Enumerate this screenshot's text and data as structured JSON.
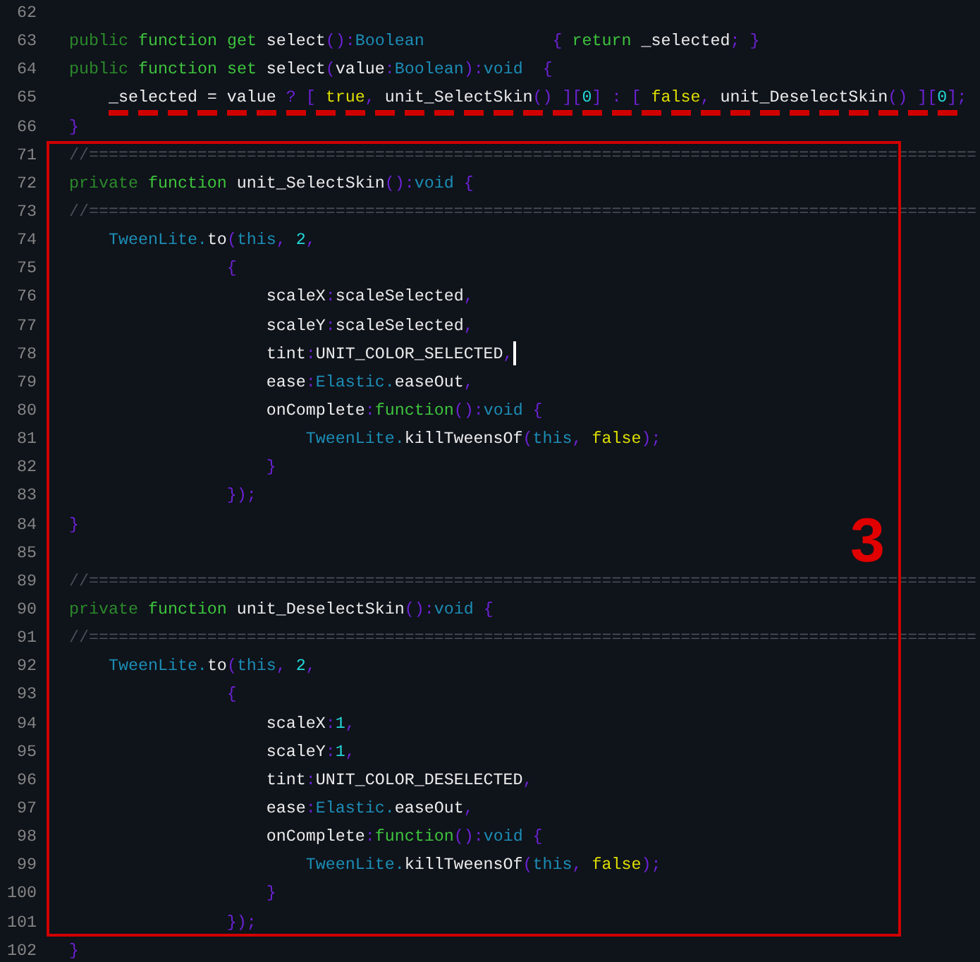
{
  "editor": {
    "lines": [
      {
        "number": "62",
        "cursor": false
      },
      {
        "number": "63",
        "cursor": false,
        "tokens": [
          {
            "kind": "storage",
            "text": "public"
          },
          {
            "kind": "keyword",
            "text": " function"
          },
          {
            "kind": "keyword",
            "text": " get"
          },
          {
            "kind": "plain",
            "text": " select"
          },
          {
            "kind": "punct",
            "text": "():"
          },
          {
            "kind": "type",
            "text": "Boolean"
          },
          {
            "kind": "punct",
            "text": "             {"
          },
          {
            "kind": "keyword",
            "text": " return"
          },
          {
            "kind": "plain",
            "text": " _selected"
          },
          {
            "kind": "punct",
            "text": "; }"
          }
        ]
      },
      {
        "number": "64",
        "cursor": false,
        "tokens": [
          {
            "kind": "storage",
            "text": "public"
          },
          {
            "kind": "keyword",
            "text": " function"
          },
          {
            "kind": "keyword",
            "text": " set"
          },
          {
            "kind": "plain",
            "text": " select"
          },
          {
            "kind": "punct",
            "text": "("
          },
          {
            "kind": "plain",
            "text": "value"
          },
          {
            "kind": "punct",
            "text": ":"
          },
          {
            "kind": "type",
            "text": "Boolean"
          },
          {
            "kind": "punct",
            "text": "):"
          },
          {
            "kind": "type",
            "text": "void"
          },
          {
            "kind": "punct",
            "text": "  {"
          }
        ]
      },
      {
        "number": "65",
        "cursor": false,
        "tokens": [
          {
            "kind": "plain",
            "text": "    _selected = value "
          },
          {
            "kind": "punct",
            "text": "? [ "
          },
          {
            "kind": "bool",
            "text": "true"
          },
          {
            "kind": "punct",
            "text": ", "
          },
          {
            "kind": "plain",
            "text": "unit_SelectSkin"
          },
          {
            "kind": "punct",
            "text": "() ]["
          },
          {
            "kind": "number",
            "text": "0"
          },
          {
            "kind": "punct",
            "text": "] : [ "
          },
          {
            "kind": "bool",
            "text": "false"
          },
          {
            "kind": "punct",
            "text": ", "
          },
          {
            "kind": "plain",
            "text": "unit_DeselectSkin"
          },
          {
            "kind": "punct",
            "text": "() ]["
          },
          {
            "kind": "number",
            "text": "0"
          },
          {
            "kind": "punct",
            "text": "];"
          }
        ]
      },
      {
        "number": "66",
        "cursor": false,
        "tokens": [
          {
            "kind": "punct",
            "text": "}"
          }
        ]
      },
      {
        "number": "71",
        "cursor": false,
        "tokens": [
          {
            "kind": "comment",
            "text": "//=========================================================================================="
          }
        ]
      },
      {
        "number": "72",
        "cursor": false,
        "tokens": [
          {
            "kind": "storage",
            "text": "private"
          },
          {
            "kind": "keyword",
            "text": " function"
          },
          {
            "kind": "plain",
            "text": " unit_SelectSkin"
          },
          {
            "kind": "punct",
            "text": "():"
          },
          {
            "kind": "type",
            "text": "void"
          },
          {
            "kind": "punct",
            "text": " {"
          }
        ]
      },
      {
        "number": "73",
        "cursor": false,
        "tokens": [
          {
            "kind": "comment",
            "text": "//=========================================================================================="
          }
        ]
      },
      {
        "number": "74",
        "cursor": false,
        "tokens": [
          {
            "kind": "type",
            "text": "    TweenLite."
          },
          {
            "kind": "plain",
            "text": "to"
          },
          {
            "kind": "punct",
            "text": "("
          },
          {
            "kind": "type",
            "text": "this"
          },
          {
            "kind": "punct",
            "text": ", "
          },
          {
            "kind": "number",
            "text": "2"
          },
          {
            "kind": "punct",
            "text": ","
          }
        ]
      },
      {
        "number": "75",
        "cursor": false,
        "tokens": [
          {
            "kind": "punct",
            "text": "                {"
          }
        ]
      },
      {
        "number": "76",
        "cursor": false,
        "tokens": [
          {
            "kind": "plain",
            "text": "                    scaleX"
          },
          {
            "kind": "punct",
            "text": ":"
          },
          {
            "kind": "plain",
            "text": "scaleSelected"
          },
          {
            "kind": "punct",
            "text": ","
          }
        ]
      },
      {
        "number": "77",
        "cursor": false,
        "tokens": [
          {
            "kind": "plain",
            "text": "                    scaleY"
          },
          {
            "kind": "punct",
            "text": ":"
          },
          {
            "kind": "plain",
            "text": "scaleSelected"
          },
          {
            "kind": "punct",
            "text": ","
          }
        ]
      },
      {
        "number": "78",
        "cursor": true,
        "tokens": [
          {
            "kind": "plain",
            "text": "                    tint"
          },
          {
            "kind": "punct",
            "text": ":"
          },
          {
            "kind": "plain",
            "text": "UNIT_COLOR_SELECTED"
          },
          {
            "kind": "punct",
            "text": ","
          }
        ]
      },
      {
        "number": "79",
        "cursor": false,
        "tokens": [
          {
            "kind": "plain",
            "text": "                    ease"
          },
          {
            "kind": "punct",
            "text": ":"
          },
          {
            "kind": "type",
            "text": "Elastic."
          },
          {
            "kind": "plain",
            "text": "easeOut"
          },
          {
            "kind": "punct",
            "text": ","
          }
        ]
      },
      {
        "number": "80",
        "cursor": false,
        "tokens": [
          {
            "kind": "plain",
            "text": "                    onComplete"
          },
          {
            "kind": "punct",
            "text": ":"
          },
          {
            "kind": "keyword",
            "text": "function"
          },
          {
            "kind": "punct",
            "text": "():"
          },
          {
            "kind": "type",
            "text": "void"
          },
          {
            "kind": "punct",
            "text": " {"
          }
        ]
      },
      {
        "number": "81",
        "cursor": false,
        "tokens": [
          {
            "kind": "type",
            "text": "                        TweenLite."
          },
          {
            "kind": "plain",
            "text": "killTweensOf"
          },
          {
            "kind": "punct",
            "text": "("
          },
          {
            "kind": "type",
            "text": "this"
          },
          {
            "kind": "punct",
            "text": ", "
          },
          {
            "kind": "bool",
            "text": "false"
          },
          {
            "kind": "punct",
            "text": ");"
          }
        ]
      },
      {
        "number": "82",
        "cursor": false,
        "tokens": [
          {
            "kind": "punct",
            "text": "                    }"
          }
        ]
      },
      {
        "number": "83",
        "cursor": false,
        "tokens": [
          {
            "kind": "punct",
            "text": "                });"
          }
        ]
      },
      {
        "number": "84",
        "cursor": false,
        "tokens": [
          {
            "kind": "punct",
            "text": "}"
          }
        ]
      },
      {
        "number": "85",
        "cursor": false
      },
      {
        "number": "89",
        "cursor": false,
        "tokens": [
          {
            "kind": "comment",
            "text": "//=========================================================================================="
          }
        ]
      },
      {
        "number": "90",
        "cursor": false,
        "tokens": [
          {
            "kind": "storage",
            "text": "private"
          },
          {
            "kind": "keyword",
            "text": " function"
          },
          {
            "kind": "plain",
            "text": " unit_DeselectSkin"
          },
          {
            "kind": "punct",
            "text": "():"
          },
          {
            "kind": "type",
            "text": "void"
          },
          {
            "kind": "punct",
            "text": " {"
          }
        ]
      },
      {
        "number": "91",
        "cursor": false,
        "tokens": [
          {
            "kind": "comment",
            "text": "//=========================================================================================="
          }
        ]
      },
      {
        "number": "92",
        "cursor": false,
        "tokens": [
          {
            "kind": "type",
            "text": "    TweenLite."
          },
          {
            "kind": "plain",
            "text": "to"
          },
          {
            "kind": "punct",
            "text": "("
          },
          {
            "kind": "type",
            "text": "this"
          },
          {
            "kind": "punct",
            "text": ", "
          },
          {
            "kind": "number",
            "text": "2"
          },
          {
            "kind": "punct",
            "text": ","
          }
        ]
      },
      {
        "number": "93",
        "cursor": false,
        "tokens": [
          {
            "kind": "punct",
            "text": "                {"
          }
        ]
      },
      {
        "number": "94",
        "cursor": false,
        "tokens": [
          {
            "kind": "plain",
            "text": "                    scaleX"
          },
          {
            "kind": "punct",
            "text": ":"
          },
          {
            "kind": "number",
            "text": "1"
          },
          {
            "kind": "punct",
            "text": ","
          }
        ]
      },
      {
        "number": "95",
        "cursor": false,
        "tokens": [
          {
            "kind": "plain",
            "text": "                    scaleY"
          },
          {
            "kind": "punct",
            "text": ":"
          },
          {
            "kind": "number",
            "text": "1"
          },
          {
            "kind": "punct",
            "text": ","
          }
        ]
      },
      {
        "number": "96",
        "cursor": false,
        "tokens": [
          {
            "kind": "plain",
            "text": "                    tint"
          },
          {
            "kind": "punct",
            "text": ":"
          },
          {
            "kind": "plain",
            "text": "UNIT_COLOR_DESELECTED"
          },
          {
            "kind": "punct",
            "text": ","
          }
        ]
      },
      {
        "number": "97",
        "cursor": false,
        "tokens": [
          {
            "kind": "plain",
            "text": "                    ease"
          },
          {
            "kind": "punct",
            "text": ":"
          },
          {
            "kind": "type",
            "text": "Elastic."
          },
          {
            "kind": "plain",
            "text": "easeOut"
          },
          {
            "kind": "punct",
            "text": ","
          }
        ]
      },
      {
        "number": "98",
        "cursor": false,
        "tokens": [
          {
            "kind": "plain",
            "text": "                    onComplete"
          },
          {
            "kind": "punct",
            "text": ":"
          },
          {
            "kind": "keyword",
            "text": "function"
          },
          {
            "kind": "punct",
            "text": "():"
          },
          {
            "kind": "type",
            "text": "void"
          },
          {
            "kind": "punct",
            "text": " {"
          }
        ]
      },
      {
        "number": "99",
        "cursor": false,
        "tokens": [
          {
            "kind": "type",
            "text": "                        TweenLite."
          },
          {
            "kind": "plain",
            "text": "killTweensOf"
          },
          {
            "kind": "punct",
            "text": "("
          },
          {
            "kind": "type",
            "text": "this"
          },
          {
            "kind": "punct",
            "text": ", "
          },
          {
            "kind": "bool",
            "text": "false"
          },
          {
            "kind": "punct",
            "text": ");"
          }
        ]
      },
      {
        "number": "100",
        "cursor": false,
        "tokens": [
          {
            "kind": "punct",
            "text": "                    }"
          }
        ]
      },
      {
        "number": "101",
        "cursor": false,
        "tokens": [
          {
            "kind": "punct",
            "text": "                });"
          }
        ]
      },
      {
        "number": "102",
        "cursor": false,
        "tokens": [
          {
            "kind": "punct",
            "text": "}"
          }
        ]
      }
    ]
  },
  "annotation": {
    "label": "3"
  }
}
